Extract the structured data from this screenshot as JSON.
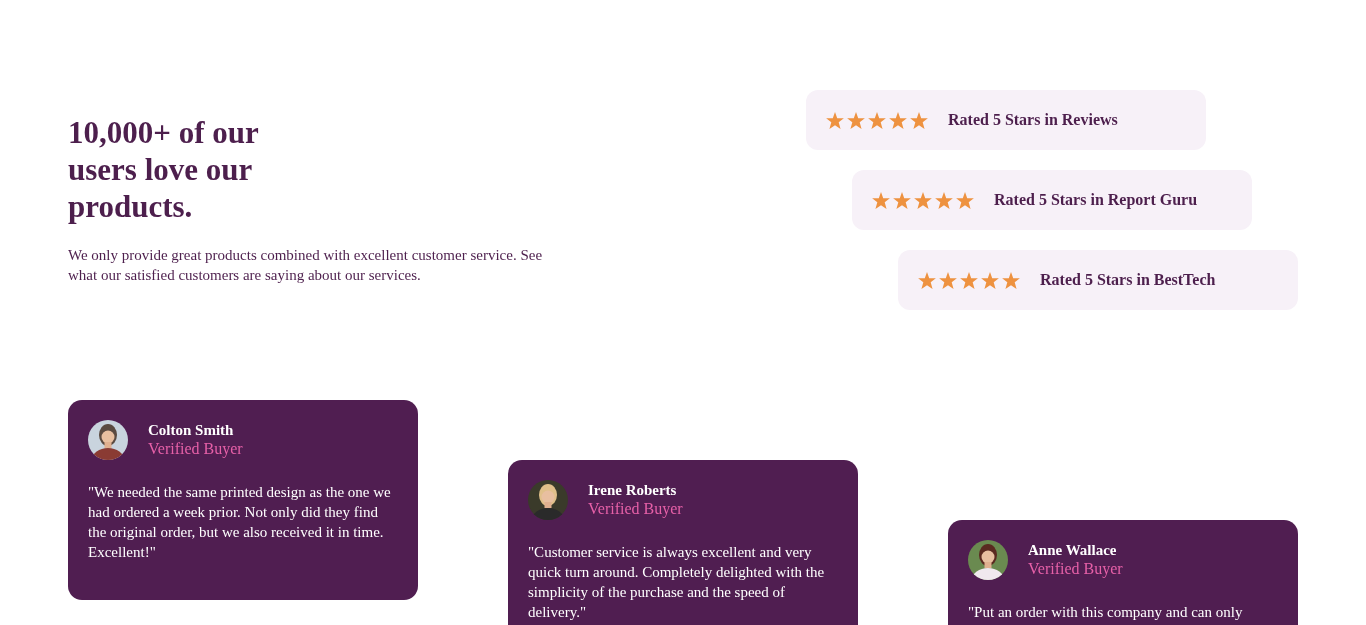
{
  "intro": {
    "heading": "10,000+ of our users love our products.",
    "text": "We only provide great products combined with excellent customer service. See what our satisfied customers are saying about our services."
  },
  "ratings": [
    {
      "stars": 5,
      "label": "Rated 5 Stars in Reviews"
    },
    {
      "stars": 5,
      "label": "Rated 5 Stars in Report Guru"
    },
    {
      "stars": 5,
      "label": "Rated 5 Stars in BestTech"
    }
  ],
  "testimonials": [
    {
      "name": "Colton Smith",
      "role": "Verified Buyer",
      "quote": "\"We needed the same printed design as the one we had ordered a week prior. Not only did they find the original order, but we also received it in time. Excellent!\""
    },
    {
      "name": "Irene Roberts",
      "role": "Verified Buyer",
      "quote": "\"Customer service is always excellent and very quick turn around. Completely delighted with the simplicity of the purchase and the speed of delivery.\""
    },
    {
      "name": "Anne Wallace",
      "role": "Verified Buyer",
      "quote": "\"Put an order with this company and can only"
    }
  ]
}
